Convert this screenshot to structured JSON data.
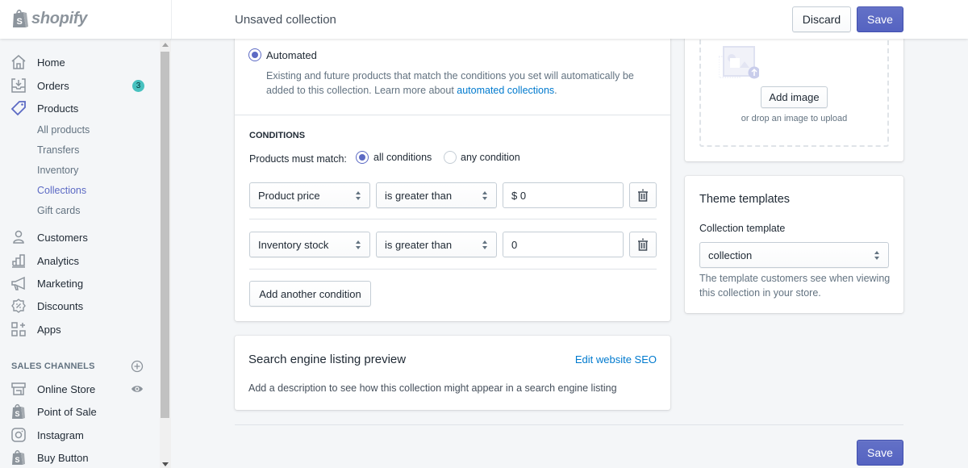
{
  "brand": {
    "name": "shopify"
  },
  "header": {
    "title": "Unsaved collection",
    "discard_label": "Discard",
    "save_label": "Save"
  },
  "sidebar": {
    "items": [
      {
        "label": "Home",
        "icon": "home-icon"
      },
      {
        "label": "Orders",
        "icon": "orders-icon",
        "badge": "3"
      },
      {
        "label": "Products",
        "icon": "tag-icon",
        "active": true
      },
      {
        "label": "Customers",
        "icon": "customer-icon"
      },
      {
        "label": "Analytics",
        "icon": "analytics-icon"
      },
      {
        "label": "Marketing",
        "icon": "megaphone-icon"
      },
      {
        "label": "Discounts",
        "icon": "discount-icon"
      },
      {
        "label": "Apps",
        "icon": "apps-icon"
      }
    ],
    "product_subitems": [
      {
        "label": "All products"
      },
      {
        "label": "Transfers"
      },
      {
        "label": "Inventory"
      },
      {
        "label": "Collections",
        "selected": true
      },
      {
        "label": "Gift cards"
      }
    ],
    "sales_channels": {
      "heading": "SALES CHANNELS",
      "items": [
        {
          "label": "Online Store",
          "icon": "store-icon"
        },
        {
          "label": "Point of Sale",
          "icon": "shopify-bag-icon"
        },
        {
          "label": "Instagram",
          "icon": "instagram-icon"
        },
        {
          "label": "Buy Button",
          "icon": "shopify-bag-icon"
        }
      ]
    }
  },
  "collection_type": {
    "automated_label": "Automated",
    "automated_selected": true,
    "description": "Existing and future products that match the conditions you set will automatically be",
    "description_line2": "added to this collection. Learn more about ",
    "link_text": "automated collections",
    "link_suffix": "."
  },
  "conditions": {
    "heading": "CONDITIONS",
    "match_label": "Products must match:",
    "match_options": [
      {
        "label": "all conditions",
        "selected": true
      },
      {
        "label": "any condition",
        "selected": false
      }
    ],
    "rows": [
      {
        "field": "Product price",
        "operator": "is greater than",
        "value": "$ 0"
      },
      {
        "field": "Inventory stock",
        "operator": "is greater than",
        "value": "0"
      }
    ],
    "add_label": "Add another condition"
  },
  "seo": {
    "title": "Search engine listing preview",
    "edit_link": "Edit website SEO",
    "description": "Add a description to see how this collection might appear in a search engine listing"
  },
  "image_upload": {
    "add_label": "Add image",
    "hint": "or drop an image to upload"
  },
  "theme": {
    "title": "Theme templates",
    "field_label": "Collection template",
    "selected": "collection",
    "help_line1": "The template customers see when viewing",
    "help_line2": "this collection in your store."
  },
  "footer": {
    "save_label": "Save"
  },
  "colors": {
    "primary": "#5c6ac4",
    "link": "#007ace",
    "badge": "#47c1bf"
  }
}
